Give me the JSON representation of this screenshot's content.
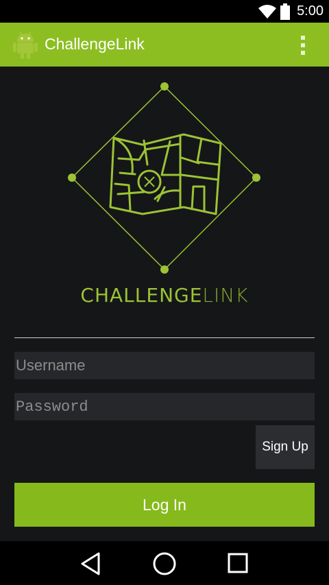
{
  "status_bar": {
    "time": "5:00",
    "icons": [
      "wifi-icon",
      "battery-icon"
    ]
  },
  "action_bar": {
    "title": "ChallengeLink",
    "icon": "android-icon",
    "menu_icon": "overflow-menu-icon"
  },
  "logo": {
    "brand_part1": "CHALLENGE",
    "brand_part2": "LINK",
    "accent_color": "#9cc335"
  },
  "form": {
    "username_placeholder": "Username",
    "username_value": "",
    "password_placeholder": "Password",
    "password_value": "",
    "signup_label": "Sign Up",
    "login_label": "Log In"
  },
  "nav_bar": {
    "back_icon": "back-icon",
    "home_icon": "home-icon",
    "recents_icon": "recents-icon"
  },
  "colors": {
    "primary": "#8cbe22",
    "background": "#151618",
    "field": "#25272a"
  }
}
